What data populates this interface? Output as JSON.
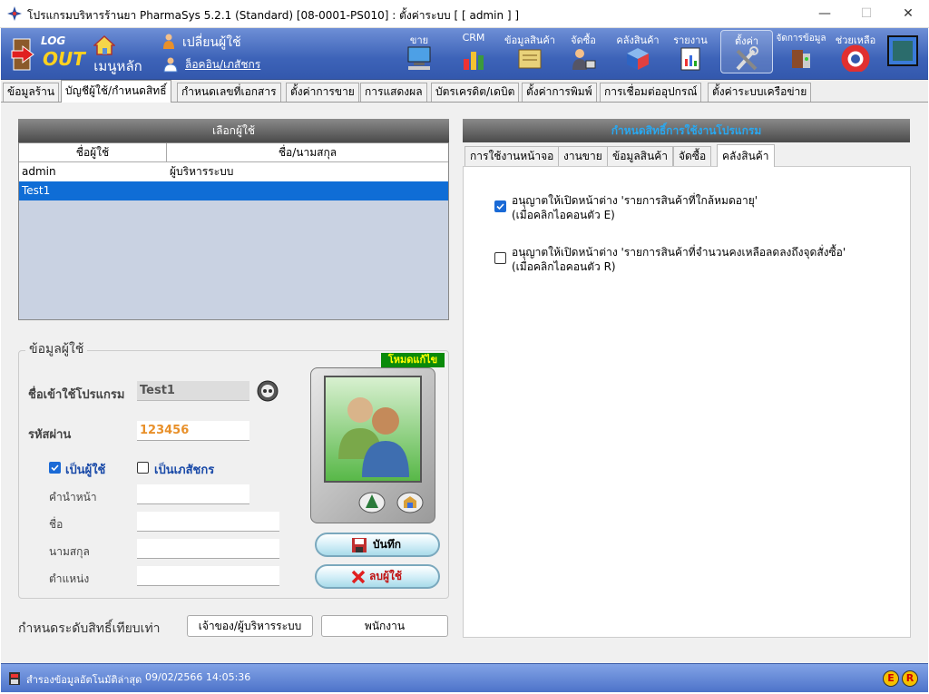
{
  "window": {
    "title": "โปรแกรมบริหารร้านยา PharmaSys 5.2.1 (Standard) [08-0001-PS010] : ตั้งค่าระบบ  [ [ admin ] ]",
    "minimize": "—",
    "maximize": "☐",
    "close": "✕"
  },
  "toolbar": {
    "logout_top": "LOG",
    "logout_bottom": "OUT",
    "home": "เมนูหลัก",
    "change_user": "เปลี่ยนผู้ใช้",
    "log_off": "ล็อคอิน/เภสัชกร",
    "buttons": [
      {
        "label": "ขาย",
        "icon": "computer-icon"
      },
      {
        "label": "CRM",
        "icon": "chart-icon"
      },
      {
        "label": "ข้อมูลสินค้า",
        "icon": "product-icon"
      },
      {
        "label": "จัดซื้อ",
        "icon": "purchase-icon"
      },
      {
        "label": "คลังสินค้า",
        "icon": "warehouse-icon"
      },
      {
        "label": "รายงาน",
        "icon": "report-icon"
      },
      {
        "label": "ตั้งค่า",
        "icon": "tools-icon"
      },
      {
        "label": "จัดการข้อมูล",
        "icon": "database-icon"
      },
      {
        "label": "ช่วยเหลือ",
        "icon": "lifebuoy-icon"
      },
      {
        "label": "",
        "icon": "window-icon"
      }
    ]
  },
  "tabs": [
    "ข้อมูลร้าน",
    "บัญชีผู้ใช้/กำหนดสิทธิ์",
    "กำหนดเลขที่เอกสาร",
    "ตั้งค่าการขาย",
    "การแสดงผล",
    "บัตรเครดิต/เดบิต",
    "ตั้งค่าการพิมพ์",
    "การเชื่อมต่ออุปกรณ์",
    "ตั้งค่าระบบเครือข่าย"
  ],
  "user_select": {
    "header": "เลือกผู้ใช้",
    "columns": [
      "ชื่อผู้ใช้",
      "ชื่อ/นามสกุล"
    ],
    "rows": [
      {
        "username": "admin",
        "fullname": "ผู้บริหารระบบ"
      },
      {
        "username": "Test1",
        "fullname": ""
      }
    ]
  },
  "user_info": {
    "legend": "ข้อมูลผู้ใช้",
    "mode_badge": "โหมดแก้ไข",
    "login_label": "ชื่อเข้าใช้โปรแกรม",
    "login_value": "Test1",
    "password_label": "รหัสผ่าน",
    "password_value": "123456",
    "is_user_label": "เป็นผู้ใช้",
    "is_pharmacist_label": "เป็นเภสัชกร",
    "prefix_label": "คำนำหน้า",
    "name_label": "ชื่อ",
    "surname_label": "นามสกุล",
    "position_label": "ตำแหน่ง",
    "save_label": "บันทึก",
    "delete_label": "ลบผู้ใช้"
  },
  "rights": {
    "label": "กำหนดระดับสิทธิ์เทียบเท่า",
    "owner_label": "เจ้าของ/ผู้บริหารระบบ",
    "staff_label": "พนักงาน"
  },
  "perm": {
    "header": "กำหนดสิทธิ์การใช้งานโปรแกรม",
    "tabs": [
      "การใช้งานหน้าจอ",
      "งานขาย",
      "ข้อมูลสินค้า",
      "จัดซื้อ",
      "คลังสินค้า"
    ],
    "opt1_line1": "อนุญาตให้เปิดหน้าต่าง 'รายการสินค้าที่ใกล้หมดอายุ'",
    "opt1_line2": "(เมื่อคลิกไอคอนตัว E)",
    "opt2_line1": "อนุญาตให้เปิดหน้าต่าง 'รายการสินค้าที่จำนวนคงเหลือลดลงถึงจุดสั่งซื้อ'",
    "opt2_line2": "(เมื่อคลิกไอคอนตัว R)"
  },
  "status": {
    "text": "สำรองข้อมูลอัตโนมัติล่าสุด",
    "datetime": "09/02/2566 14:05:36",
    "e_label": "E",
    "r_label": "R"
  }
}
